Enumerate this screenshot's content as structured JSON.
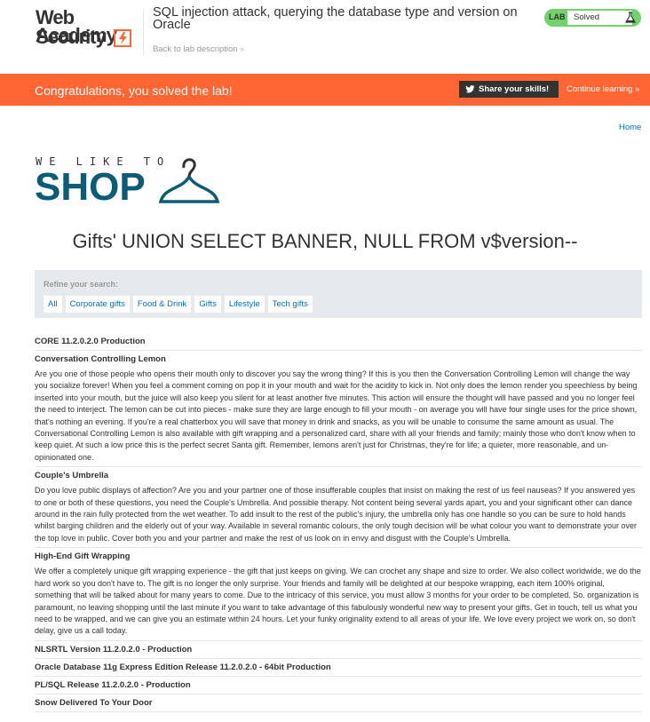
{
  "header": {
    "logo_line1": "Web Security",
    "logo_line2": "Academy",
    "lab_title": "SQL injection attack, querying the database type and version on Oracle",
    "back_link": "Back to lab description",
    "status_label": "LAB",
    "status_value": "Solved"
  },
  "banner": {
    "message": "Congratulations, you solved the lab!",
    "share_label": "Share your skills!",
    "continue_label": "Continue learning"
  },
  "nav": {
    "home_label": "Home"
  },
  "shop_logo": {
    "tagline": "WE LIKE TO",
    "word": "SHOP"
  },
  "page_title": "Gifts' UNION SELECT BANNER, NULL FROM v$version--",
  "filter": {
    "label": "Refine your search:",
    "categories": [
      "All",
      "Corporate gifts",
      "Food & Drink",
      "Gifts",
      "Lifestyle",
      "Tech gifts"
    ]
  },
  "products": [
    {
      "name": "CORE 11.2.0.2.0 Production",
      "description": ""
    },
    {
      "name": "Conversation Controlling Lemon",
      "description": "Are you one of those people who opens their mouth only to discover you say the wrong thing? If this is you then the Conversation Controlling Lemon will change the way you socialize forever! When you feel a comment coming on pop it in your mouth and wait for the acidity to kick in. Not only does the lemon render you speechless by being inserted into your mouth, but the juice will also keep you silent for at least another five minutes. This action will ensure the thought will have passed and you no longer feel the need to interject. The lemon can be cut into pieces - make sure they are large enough to fill your mouth - on average you will have four single uses for the price shown, that's nothing an evening. If you're a real chatterbox you will save that money in drink and snacks, as you will be unable to consume the same amount as usual. The Conversational Controlling Lemon is also available with gift wrapping and a personalized card, share with all your friends and family; mainly those who don't know when to keep quiet. At such a low price this is the perfect secret Santa gift. Remember, lemons aren't just for Christmas, they're for life; a quieter, more reasonable, and un-opinionated one."
    },
    {
      "name": "Couple's Umbrella",
      "description": "Do you love public displays of affection? Are you and your partner one of those insufferable couples that insist on making the rest of us feel nauseas? If you answered yes to one or both of these questions, you need the Couple's Umbrella. And possible therapy. Not content being several yards apart, you and your significant other can dance around in the rain fully protected from the wet weather. To add insult to the rest of the public's injury, the umbrella only has one handle so you can be sure to hold hands whilst barging children and the elderly out of your way. Available in several romantic colours, the only tough decision will be what colour you want to demonstrate your over the top love in public. Cover both you and your partner and make the rest of us look on in envy and disgust with the Couple's Umbrella."
    },
    {
      "name": "High-End Gift Wrapping",
      "description": "We offer a completely unique gift wrapping experience - the gift that just keeps on giving. We can crochet any shape and size to order. We also collect worldwide, we do the hard work so you don't have to. The gift is no longer the only surprise. Your friends and family will be delighted at our bespoke wrapping, each item 100% original, something that will be talked about for many years to come. Due to the intricacy of this service, you must allow 3 months for your order to be completed. So. organization is paramount, no leaving shopping until the last minute if you want to take advantage of this fabulously wonderful new way to present your gifts. Get in touch, tell us what you need to be wrapped, and we can give you an estimate within 24 hours. Let your funky originality extend to all areas of your life. We love every project we work on, so don't delay, give us a call today."
    },
    {
      "name": "NLSRTL Version 11.2.0.2.0 - Production",
      "description": ""
    },
    {
      "name": "Oracle Database 11g Express Edition Release 11.2.0.2.0 - 64bit Production",
      "description": ""
    },
    {
      "name": "PL/SQL Release 11.2.0.2.0 - Production",
      "description": ""
    },
    {
      "name": "Snow Delivered To Your Door",
      "description": ""
    }
  ],
  "colors": {
    "accent": "#ff6633",
    "status": "#70d16d",
    "link": "#0071bc",
    "shop_blue": "#0b5c76"
  }
}
